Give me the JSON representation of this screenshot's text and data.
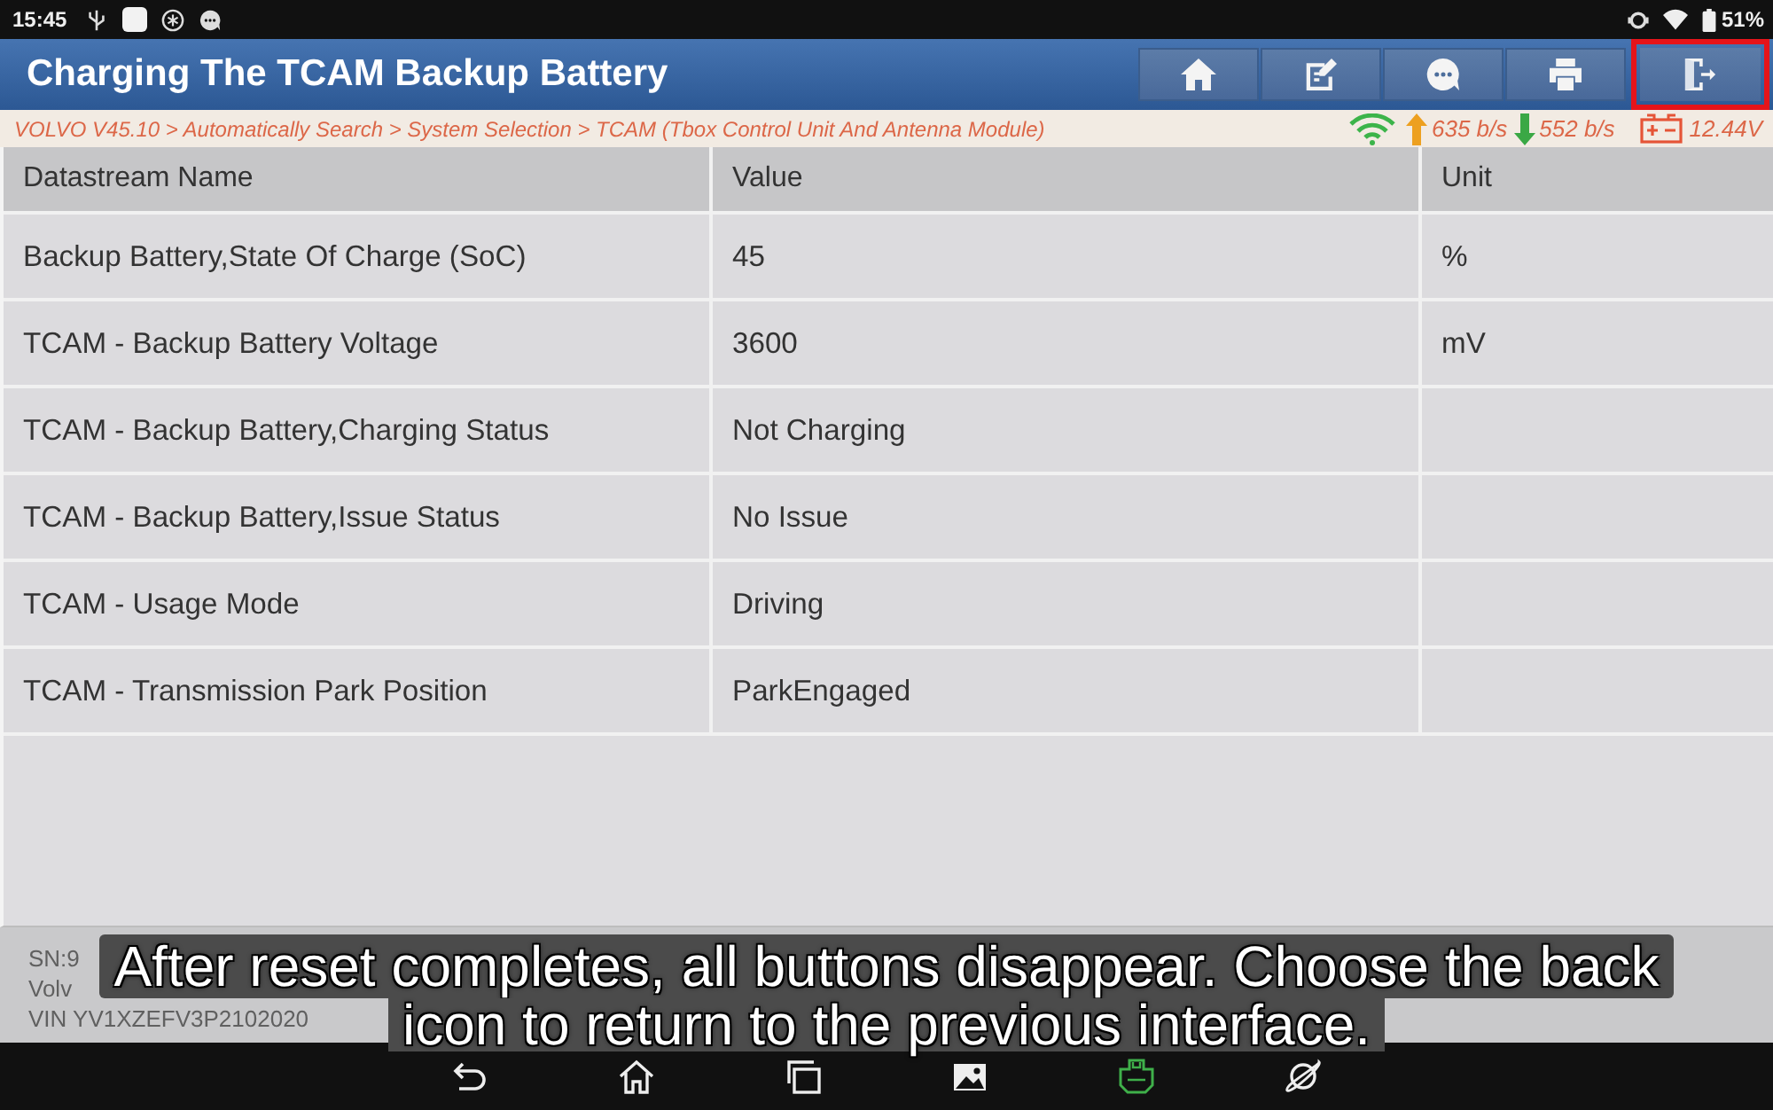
{
  "status_bar": {
    "time": "15:45",
    "battery": "51%"
  },
  "window": {
    "title": "Charging The TCAM Backup Battery"
  },
  "toolbar": [
    {
      "kind": "home",
      "highlighted": false
    },
    {
      "kind": "edit",
      "highlighted": false
    },
    {
      "kind": "message",
      "highlighted": false
    },
    {
      "kind": "print",
      "highlighted": false
    },
    {
      "kind": "exit",
      "highlighted": true
    }
  ],
  "breadcrumb": "VOLVO V45.10 > Automatically Search > System Selection > TCAM (Tbox Control Unit And Antenna Module)",
  "connection": {
    "upload": "635 b/s",
    "download": "552 b/s",
    "voltage": "12.44V"
  },
  "table": {
    "columns": [
      "Datastream Name",
      "Value",
      "Unit"
    ],
    "rows": [
      {
        "name": "Backup Battery,State Of Charge (SoC)",
        "value": "45",
        "unit": "%"
      },
      {
        "name": "TCAM - Backup Battery Voltage",
        "value": "3600",
        "unit": "mV"
      },
      {
        "name": "TCAM - Backup Battery,Charging Status",
        "value": "Not Charging"
      },
      {
        "name": "TCAM - Backup Battery,Issue Status",
        "value": "No Issue"
      },
      {
        "name": "TCAM - Usage Mode",
        "value": "Driving"
      },
      {
        "name": "TCAM - Transmission Park Position",
        "value": "ParkEngaged"
      }
    ]
  },
  "vehicle_info": [
    "SN:9",
    "Volv",
    "VIN YV1XZEFV3P2102020"
  ],
  "caption_lines": [
    "After reset completes, all buttons disappear. Choose the back",
    "icon to return to the previous interface."
  ]
}
